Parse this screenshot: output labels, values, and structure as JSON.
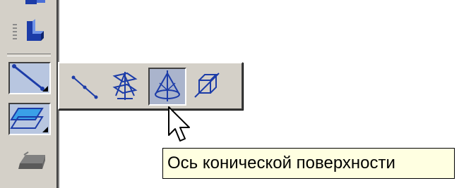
{
  "tooltip": {
    "text": "Ось конической поверхности"
  },
  "toolbar": {
    "buttons": [
      {
        "icon": "plane-tool-icon"
      },
      {
        "icon": "corner-profile-icon"
      },
      {
        "icon": "auxiliary-axis-icon",
        "state": "pressed"
      },
      {
        "icon": "auxiliary-plane-icon",
        "state": "pressed"
      },
      {
        "icon": "solid-plate-icon",
        "state": "disabled"
      }
    ]
  },
  "flyout": {
    "buttons": [
      {
        "icon": "axis-through-two-vertices-icon"
      },
      {
        "icon": "axis-intersection-of-planes-icon"
      },
      {
        "icon": "conical-surface-axis-icon",
        "state": "active"
      },
      {
        "icon": "axis-through-edge-icon"
      }
    ]
  },
  "colors": {
    "face": "#d4d0c8",
    "tooltip_bg": "#ffffe1",
    "pressed_bg": "#b8c6e0",
    "active_bg": "#aab4cc",
    "icon_blue": "#1c3ca8"
  }
}
